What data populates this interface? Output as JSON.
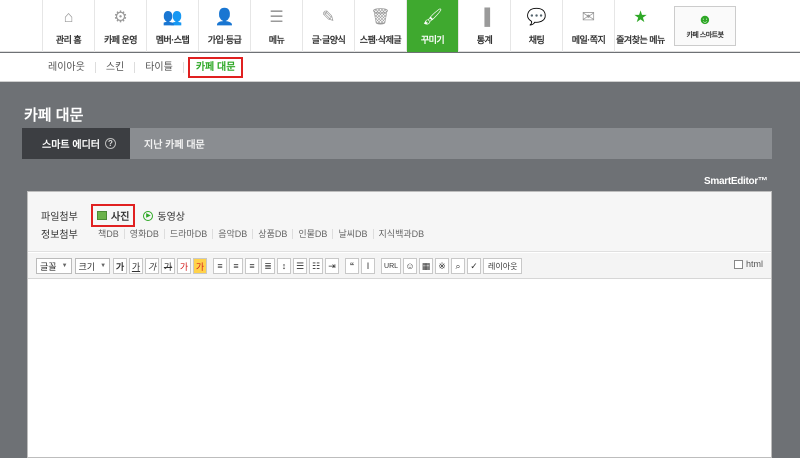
{
  "top_menu": [
    {
      "label": "관리 홈",
      "icon": "home-icon",
      "glyph": "⌂"
    },
    {
      "label": "카페 운영",
      "icon": "gear-icon",
      "glyph": "⚙"
    },
    {
      "label": "멤버·스탭",
      "icon": "members-icon",
      "glyph": "👥"
    },
    {
      "label": "가입·등급",
      "icon": "user-join-icon",
      "glyph": "👤"
    },
    {
      "label": "메뉴",
      "icon": "menu-icon",
      "glyph": "☰"
    },
    {
      "label": "글·글양식",
      "icon": "pencil-icon",
      "glyph": "✎"
    },
    {
      "label": "스팸·삭제글",
      "icon": "trash-icon",
      "glyph": "🗑"
    },
    {
      "label": "꾸미기",
      "icon": "brush-icon",
      "glyph": "🖌"
    },
    {
      "label": "통계",
      "icon": "bar-chart-icon",
      "glyph": "▐"
    },
    {
      "label": "채팅",
      "icon": "chat-icon",
      "glyph": "💬"
    },
    {
      "label": "메일·쪽지",
      "icon": "mail-icon",
      "glyph": "✉"
    },
    {
      "label": "즐겨찾는 메뉴",
      "icon": "star-icon",
      "glyph": "★"
    }
  ],
  "smart_button": {
    "label": "카페 스마트봇",
    "icon": "robot-icon",
    "glyph": "☻"
  },
  "sub_menu": [
    "레이아웃",
    "스킨",
    "타이틀",
    "카페 대문"
  ],
  "page_title": "카페 대문",
  "tabs": {
    "active": "스마트 에디터",
    "help": "?",
    "inactive": "지난 카페 대문"
  },
  "brand": "SmartEditor™",
  "attach": {
    "file_label": "파일첨부",
    "photo": "사진",
    "video": "동영상",
    "info_label": "정보첨부",
    "db_items": [
      "책DB",
      "영화DB",
      "드라마DB",
      "음악DB",
      "상품DB",
      "인물DB",
      "날씨DB",
      "지식백과DB"
    ]
  },
  "toolbar": {
    "font": "글꼴",
    "size": "크기",
    "bold": "가",
    "underline": "가",
    "italic": "가",
    "strike": "가",
    "color": "가",
    "bgcolor": "가",
    "url": "URL",
    "layout": "레이아웃",
    "html": "html"
  },
  "colors": {
    "active_menu": "#3fa92f",
    "highlight_border": "#e02020"
  }
}
